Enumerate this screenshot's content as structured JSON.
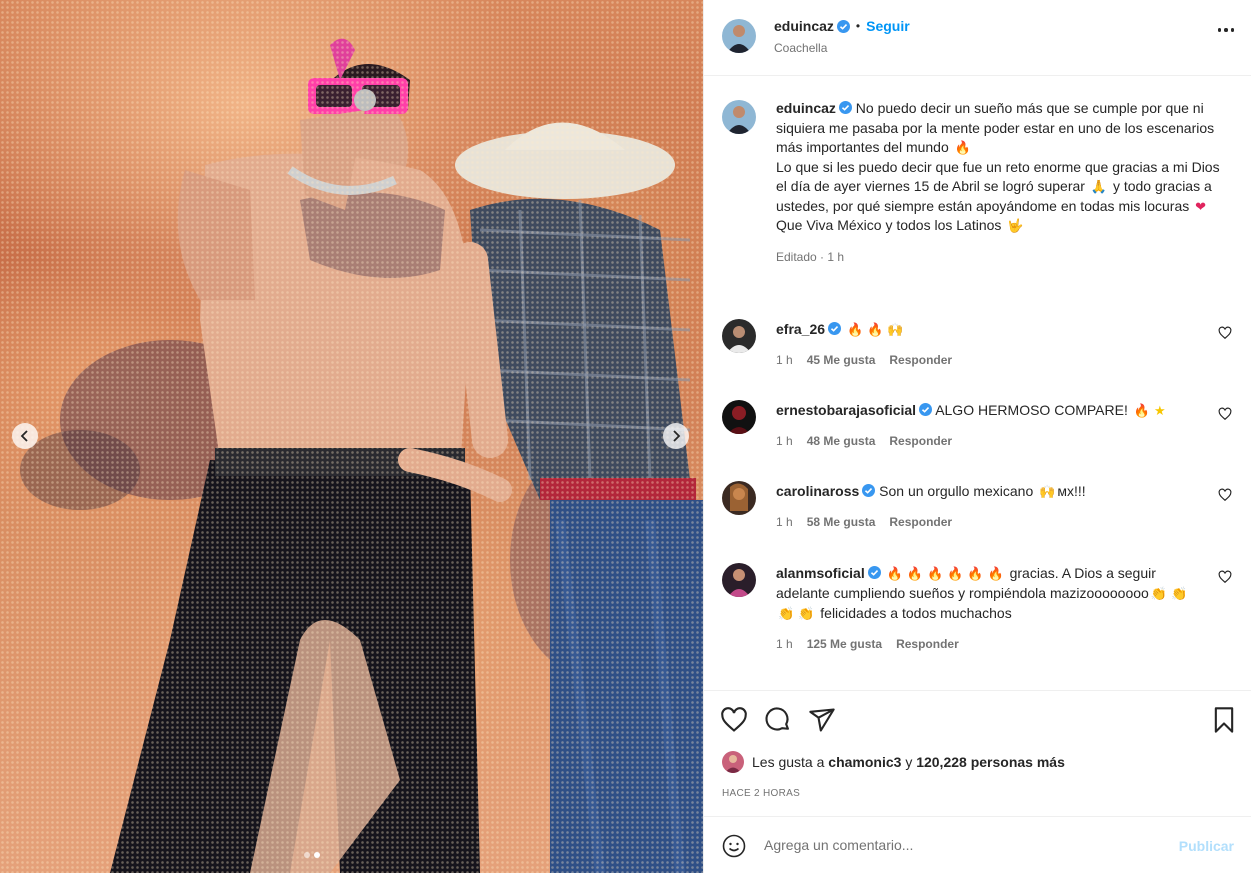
{
  "header": {
    "username": "eduincaz",
    "dot": "•",
    "follow_label": "Seguir",
    "location": "Coachella"
  },
  "caption": {
    "username": "eduincaz",
    "line1": "No puedo decir un sueño más que se cumple por que ni siquiera me pasaba por la mente poder estar en uno de los escenarios más importantes del mundo",
    "line2a": "Lo que si les puedo decir que fue un reto enorme que gracias a mi Dios el día de ayer viernes 15 de Abril se logró superar",
    "line2b": "y todo gracias a ustedes, por qué siempre están apoyándome en todas mis locuras",
    "line3": "Que Viva México y todos los Latinos",
    "meta": "Editado · 1 h"
  },
  "comments": [
    {
      "username": "efra_26",
      "text": "",
      "time": "1 h",
      "likes": "45 Me gusta",
      "reply": "Responder"
    },
    {
      "username": "ernestobarajasoficial",
      "text": "ALGO HERMOSO COMPARE!",
      "time": "1 h",
      "likes": "48 Me gusta",
      "reply": "Responder"
    },
    {
      "username": "carolinaross",
      "text": "Son un orgullo mexicano",
      "text2": "ᴍx!!!",
      "time": "1 h",
      "likes": "58 Me gusta",
      "reply": "Responder"
    },
    {
      "username": "alanmsoficial",
      "text": "gracias. A Dios a seguir adelante cumpliendo sueños y rompiéndola mazizoooooooo",
      "text2": "felicidades a todos muchachos",
      "time": "1 h",
      "likes": "125 Me gusta",
      "reply": "Responder"
    }
  ],
  "likes": {
    "prefix": "Les gusta a",
    "user": "chamonic3",
    "join": "y",
    "others": "120,228 personas más"
  },
  "timestamp": "HACE 2 HORAS",
  "compose": {
    "placeholder": "Agrega un comentario...",
    "publish_label": "Publicar"
  },
  "colors": {
    "accent": "#0095f6",
    "verified": "#3897f0",
    "publish_disabled": "#b2dffc",
    "muted": "#737373"
  },
  "icons": [
    "verified-badge-icon",
    "more-options-icon",
    "heart-icon",
    "comment-icon",
    "share-icon",
    "bookmark-icon",
    "emoji-icon",
    "chevron-left-icon",
    "chevron-right-icon"
  ]
}
